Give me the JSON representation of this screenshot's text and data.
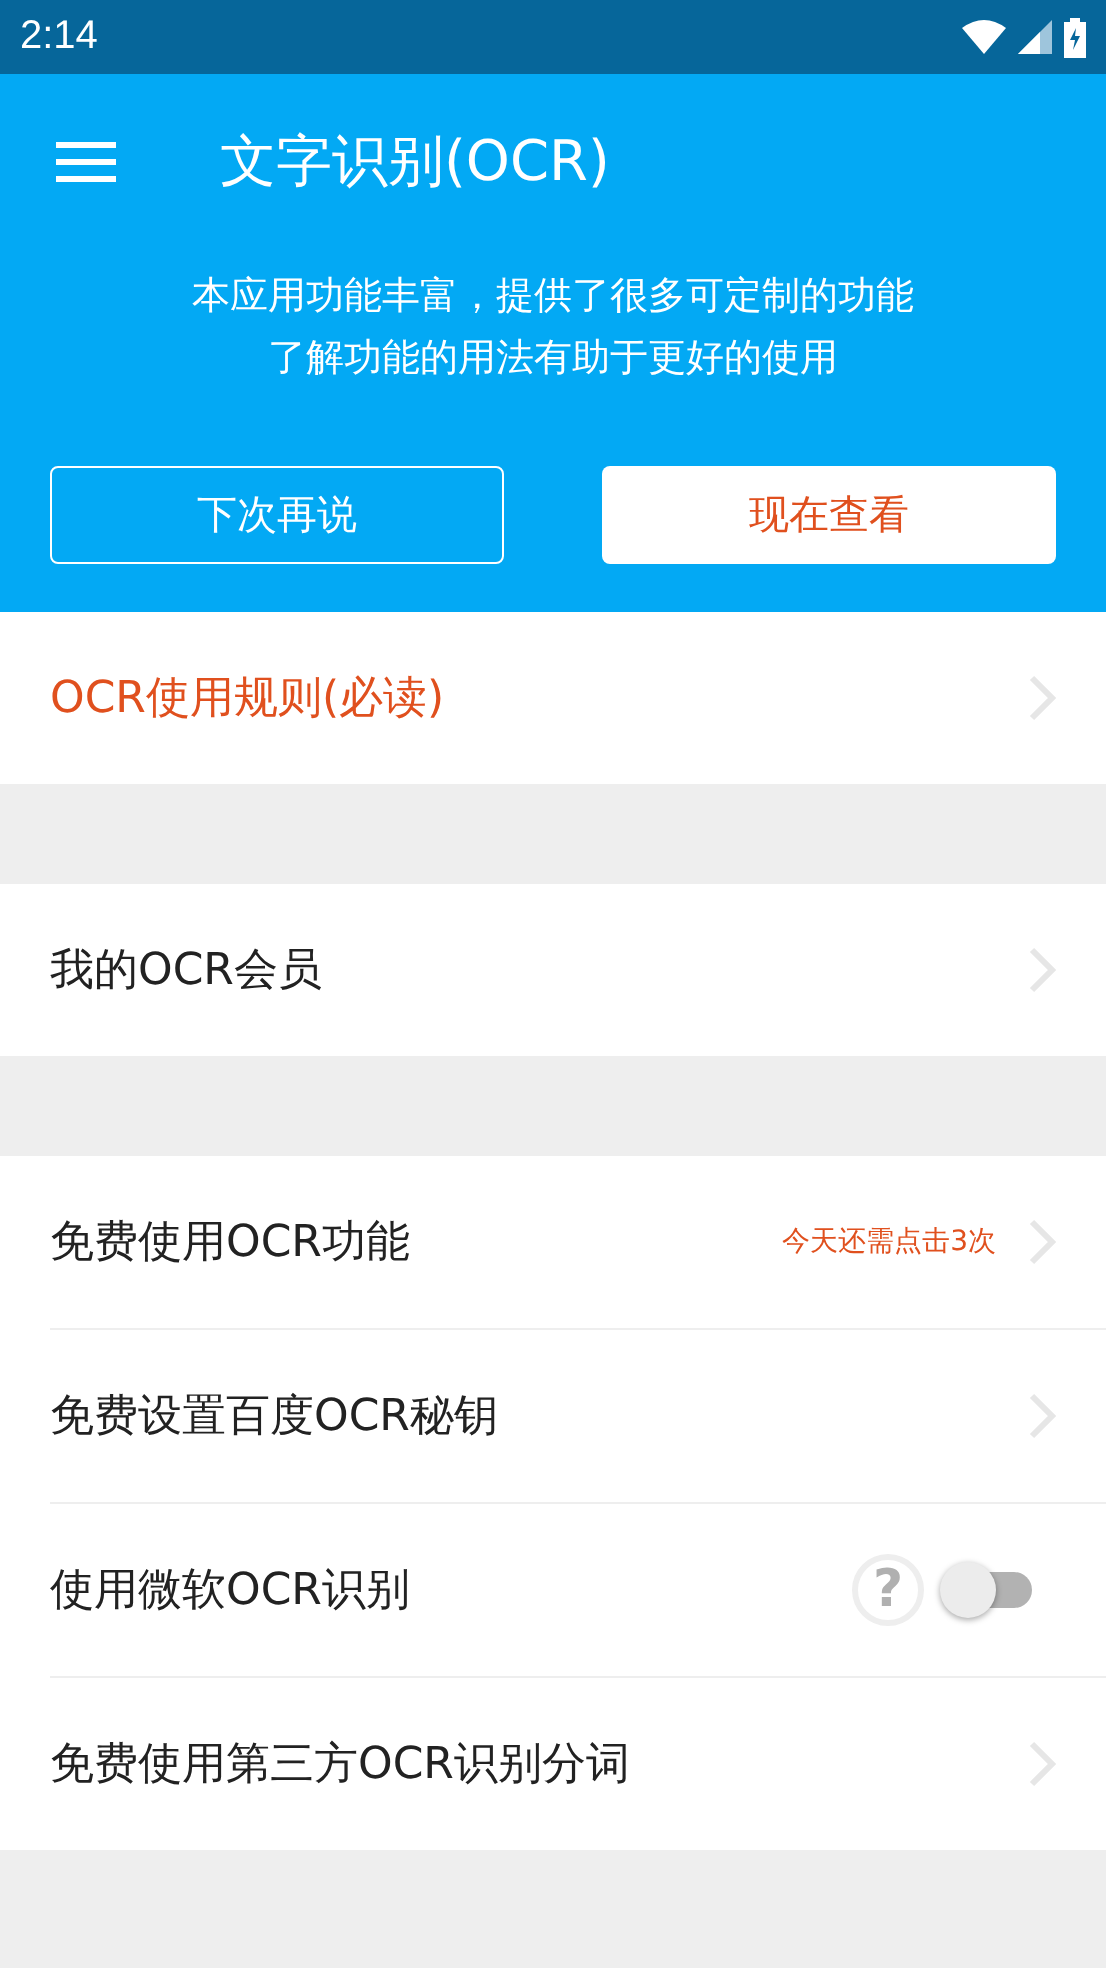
{
  "status_bar": {
    "time": "2:14"
  },
  "app_bar": {
    "title": "文字识别(OCR)"
  },
  "banner": {
    "message": [
      "本应用功能丰富，提供了很多可定制的功能",
      "了解功能的用法有助于更好的使用"
    ],
    "buttons": [
      {
        "label": "下次再说",
        "kind": "outline"
      },
      {
        "label": "现在查看",
        "kind": "filled"
      }
    ]
  },
  "sections": [
    {
      "items": [
        {
          "kind": "link",
          "label": "OCR使用规则(必读)",
          "accent": true
        }
      ]
    },
    {
      "items": [
        {
          "kind": "link",
          "label": "我的OCR会员",
          "accent": false
        }
      ]
    },
    {
      "items": [
        {
          "kind": "link",
          "label": "免费使用OCR功能",
          "accent": false,
          "note": "今天还需点击3次"
        },
        {
          "kind": "link",
          "label": "免费设置百度OCR秘钥",
          "accent": false
        },
        {
          "kind": "toggle",
          "label": "使用微软OCR识别",
          "accent": false,
          "help": "?",
          "on": false
        },
        {
          "kind": "link",
          "label": "免费使用第三方OCR识别分词",
          "accent": false
        }
      ]
    }
  ]
}
